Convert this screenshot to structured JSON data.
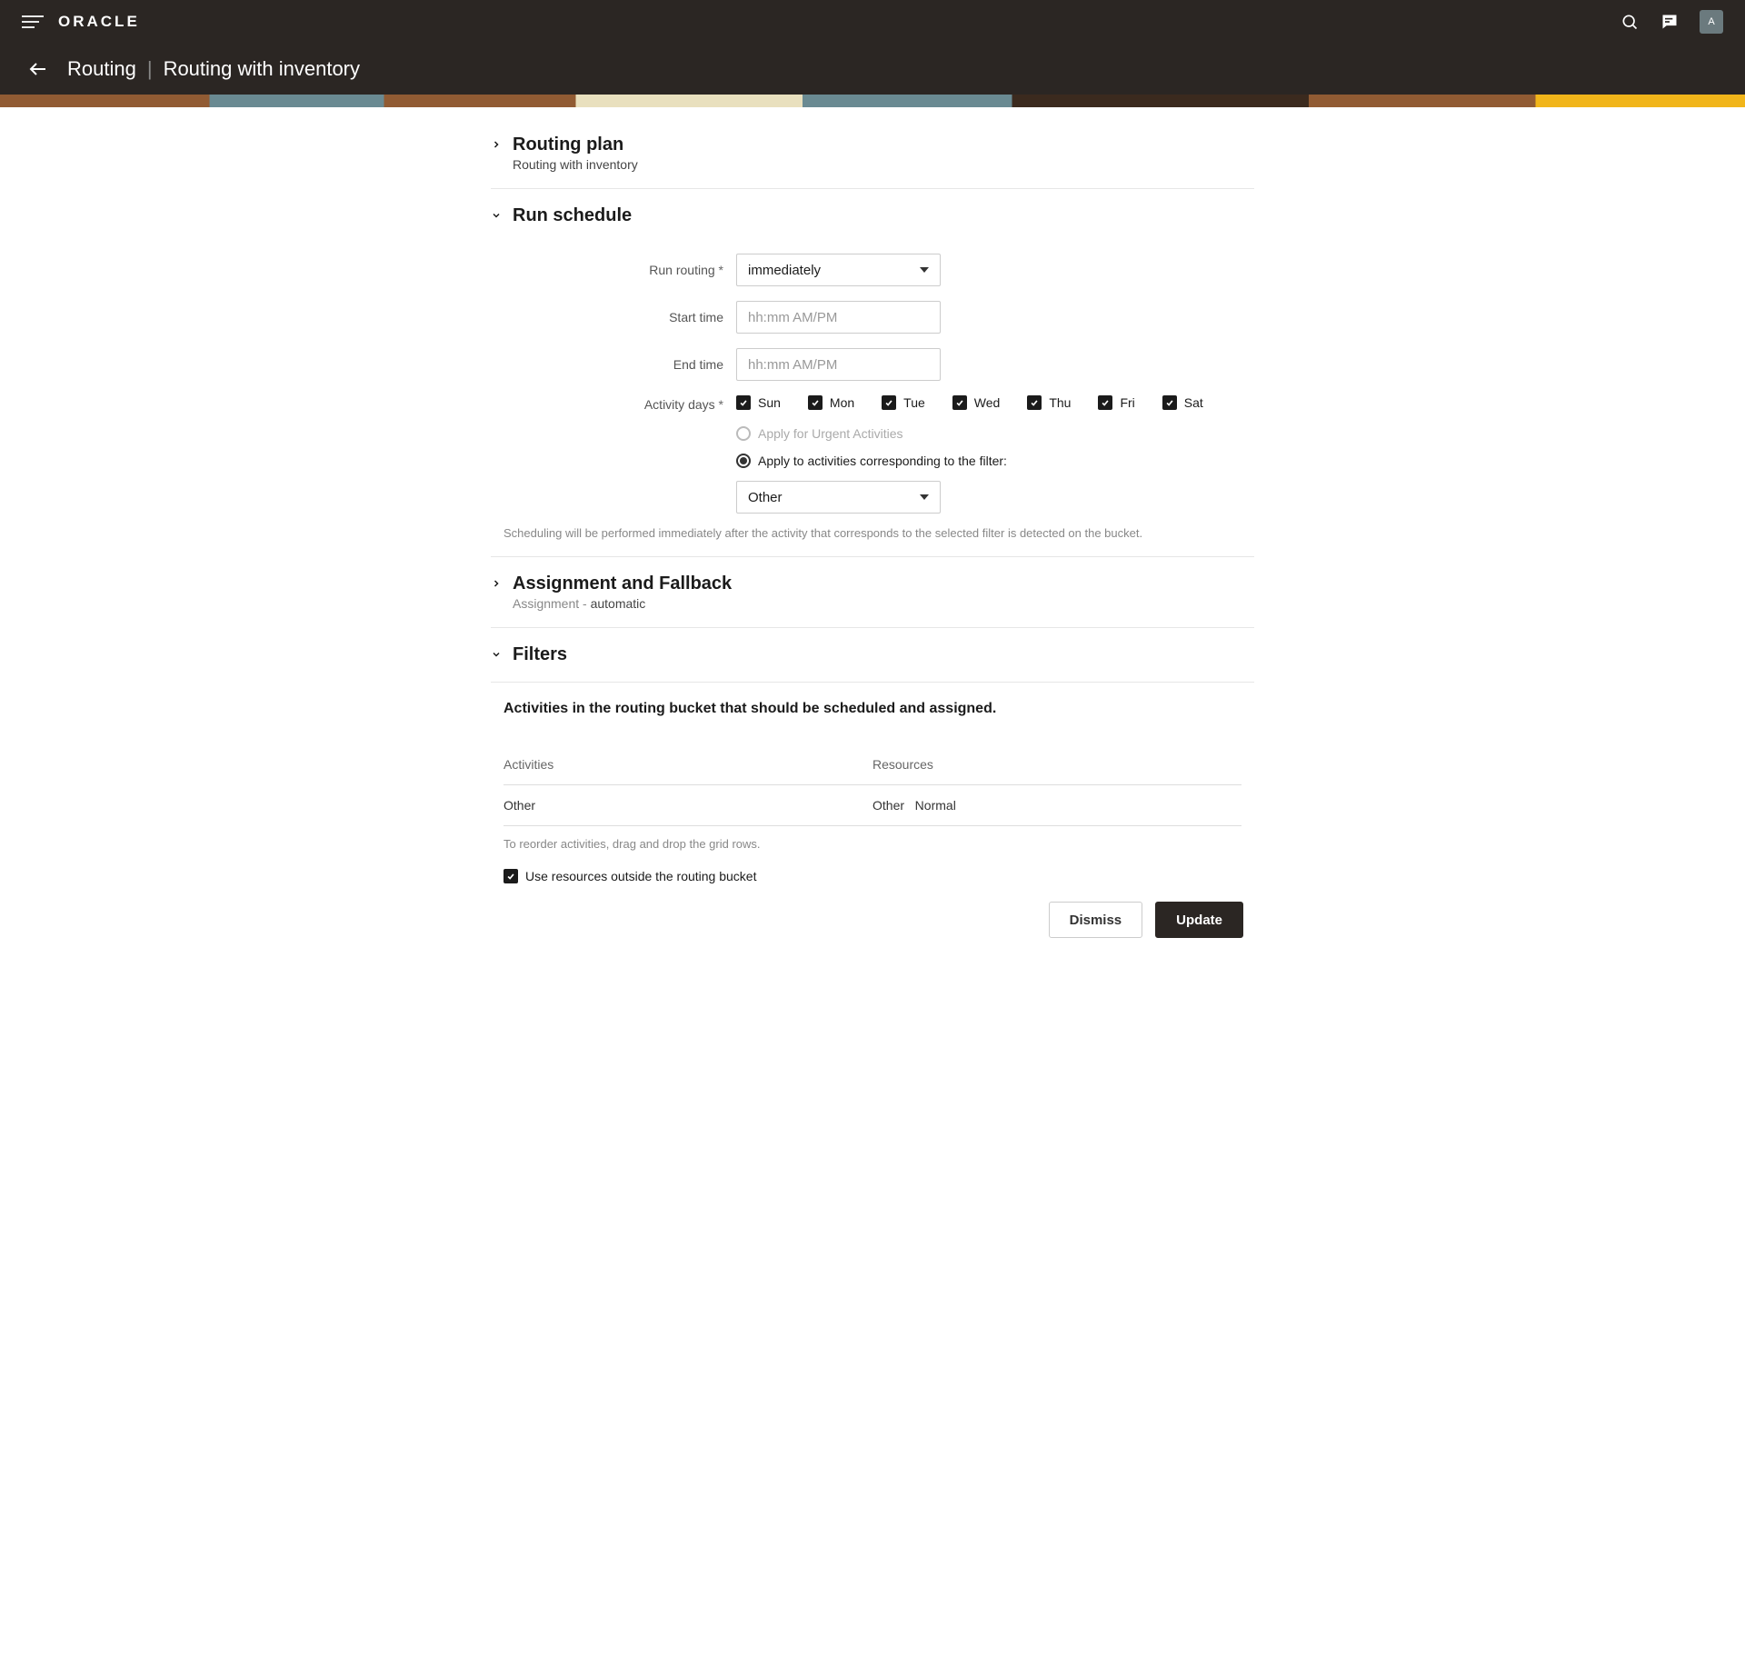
{
  "header": {
    "logo_text": "ORACLE",
    "avatar_initial": "A"
  },
  "breadcrumb": {
    "parent": "Routing",
    "current": "Routing with inventory"
  },
  "sections": {
    "routing_plan": {
      "title": "Routing plan",
      "subtitle": "Routing with inventory"
    },
    "run_schedule": {
      "title": "Run schedule"
    },
    "assignment": {
      "title": "Assignment and Fallback",
      "subtitle_prefix": "Assignment - ",
      "subtitle_value": "automatic"
    },
    "filters": {
      "title": "Filters"
    }
  },
  "form": {
    "run_routing_label": "Run routing",
    "run_routing_value": "immediately",
    "start_time_label": "Start time",
    "start_time_placeholder": "hh:mm AM/PM",
    "end_time_label": "End time",
    "end_time_placeholder": "hh:mm AM/PM",
    "activity_days_label": "Activity days",
    "days": [
      "Sun",
      "Mon",
      "Tue",
      "Wed",
      "Thu",
      "Fri",
      "Sat"
    ],
    "urgent_label": "Apply for Urgent Activities",
    "filter_radio_label": "Apply to activities corresponding to the filter:",
    "filter_select_value": "Other",
    "schedule_hint": "Scheduling will be performed immediately after the activity that corresponds to the selected filter is detected on the bucket."
  },
  "filters": {
    "heading": "Activities in the routing bucket that should be scheduled and assigned.",
    "col_activities": "Activities",
    "col_resources": "Resources",
    "row": {
      "activities": "Other",
      "resources": "Other   Normal"
    },
    "reorder_hint": "To reorder activities, drag and drop the grid rows.",
    "outside_bucket_label": "Use resources outside the routing bucket"
  },
  "buttons": {
    "dismiss": "Dismiss",
    "update": "Update"
  }
}
